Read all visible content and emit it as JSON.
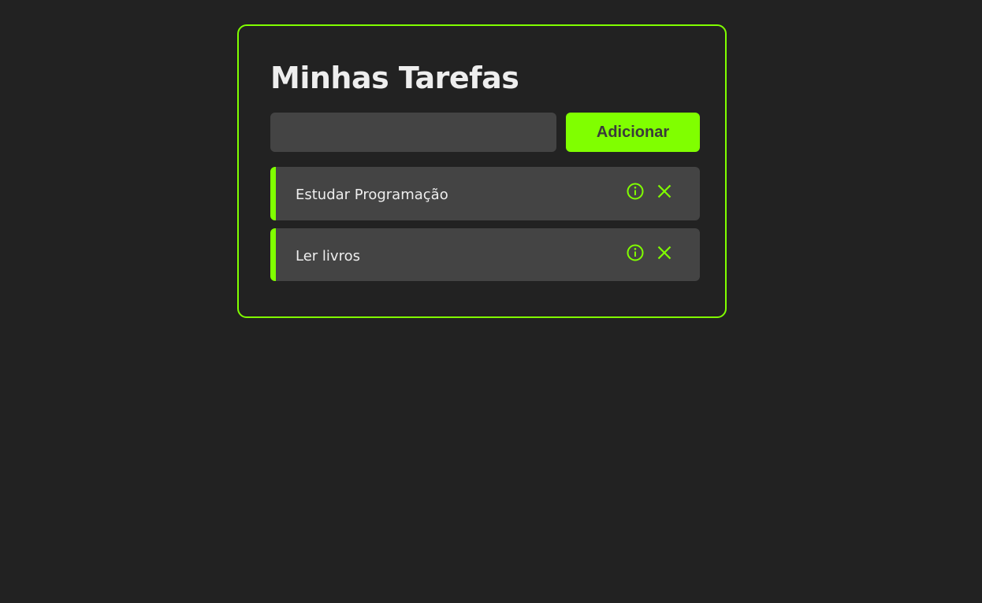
{
  "app": {
    "title": "Minhas Tarefas"
  },
  "form": {
    "input_value": "",
    "input_placeholder": "",
    "add_label": "Adicionar"
  },
  "tasks": [
    {
      "label": "Estudar Programação",
      "info_icon": "info-icon",
      "delete_icon": "close-icon"
    },
    {
      "label": "Ler livros",
      "info_icon": "info-icon",
      "delete_icon": "close-icon"
    }
  ],
  "colors": {
    "background": "#222222",
    "accent": "#80ff00",
    "surface": "#444444",
    "text": "#eeeeee"
  }
}
